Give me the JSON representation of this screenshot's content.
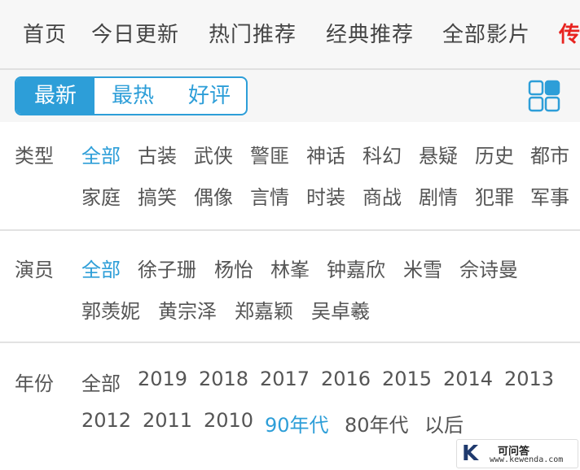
{
  "nav": {
    "items": [
      "首页",
      "今日更新",
      "热门推荐",
      "经典推荐",
      "全部影片",
      "传"
    ]
  },
  "sort": {
    "tabs": [
      "最新",
      "最热",
      "好评"
    ],
    "active": "最新"
  },
  "filters": {
    "type": {
      "label": "类型",
      "row1": [
        "全部",
        "古装",
        "武侠",
        "警匪",
        "神话",
        "科幻",
        "悬疑",
        "历史",
        "都市"
      ],
      "row2": [
        "家庭",
        "搞笑",
        "偶像",
        "言情",
        "时装",
        "商战",
        "剧情",
        "犯罪",
        "军事"
      ],
      "selected": "全部"
    },
    "actor": {
      "label": "演员",
      "row1": [
        "全部",
        "徐子珊",
        "杨怡",
        "林峯",
        "钟嘉欣",
        "米雪",
        "佘诗曼"
      ],
      "row2": [
        "郭羡妮",
        "黄宗泽",
        "郑嘉颖",
        "吴卓羲"
      ],
      "selected": "全部"
    },
    "year": {
      "label": "年份",
      "row1": [
        "全部",
        "2019",
        "2018",
        "2017",
        "2016",
        "2015",
        "2014",
        "2013"
      ],
      "row2": [
        "2012",
        "2011",
        "2010",
        "90年代",
        "80年代",
        "以后"
      ],
      "selected": "90年代"
    }
  },
  "icons": {
    "view_toggle": "grid-view-icon"
  },
  "colors": {
    "accent": "#2d9ed8",
    "highlight": "#e8231f",
    "text": "#555555"
  },
  "watermark": {
    "letter": "K",
    "title": "可问答",
    "url": "www.kewenda.com"
  }
}
